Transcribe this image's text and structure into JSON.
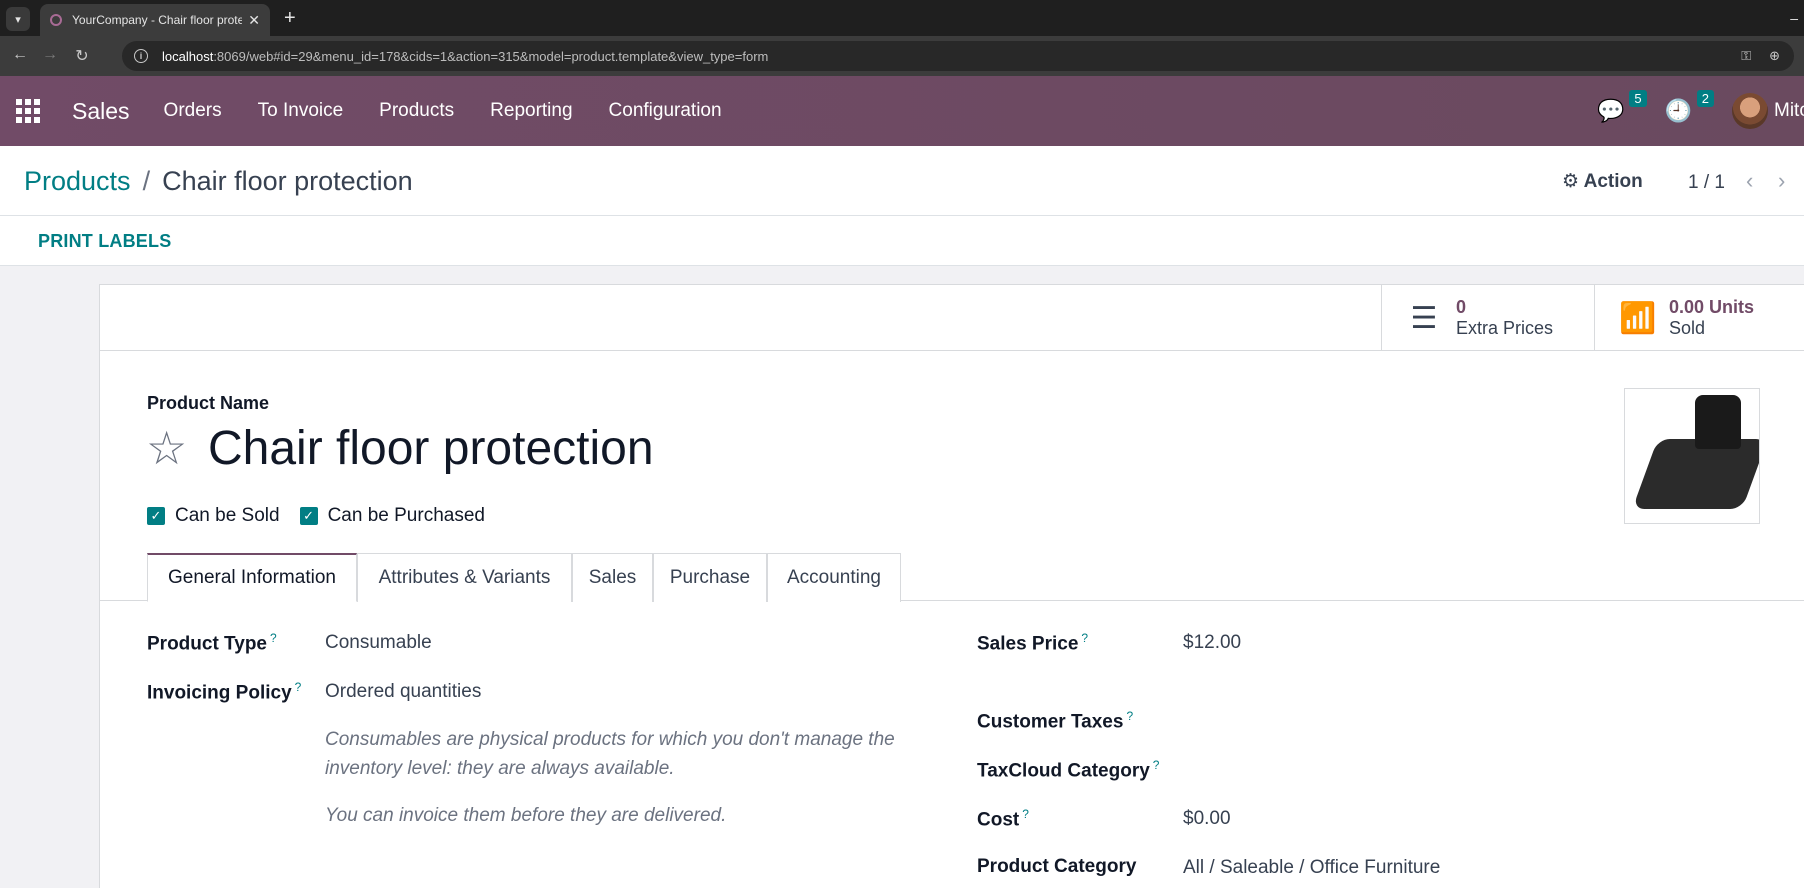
{
  "browser": {
    "tab_title": "YourCompany - Chair floor protection",
    "url_host": "localhost",
    "url_rest": ":8069/web#id=29&menu_id=178&cids=1&action=315&model=product.template&view_type=form"
  },
  "navbar": {
    "app_name": "Sales",
    "menu": [
      "Orders",
      "To Invoice",
      "Products",
      "Reporting",
      "Configuration"
    ],
    "messages_count": "5",
    "activities_count": "2",
    "user_name": "Mitchell Admin"
  },
  "control": {
    "breadcrumb_parent": "Products",
    "breadcrumb_sep": "/",
    "breadcrumb_current": "Chair floor protection",
    "action_label": "Action",
    "pager": "1 / 1"
  },
  "statusbar": {
    "print_labels": "PRINT LABELS"
  },
  "stat_buttons": {
    "extra_prices_value": "0",
    "extra_prices_label": "Extra Prices",
    "units_sold_value": "0.00 Units",
    "units_sold_label": "Sold"
  },
  "form": {
    "product_name_label": "Product Name",
    "product_name": "Chair floor protection",
    "can_be_sold": "Can be Sold",
    "can_be_purchased": "Can be Purchased",
    "tabs": [
      "General Information",
      "Attributes & Variants",
      "Sales",
      "Purchase",
      "Accounting"
    ],
    "fields": {
      "product_type_label": "Product Type",
      "product_type_value": "Consumable",
      "invoicing_policy_label": "Invoicing Policy",
      "invoicing_policy_value": "Ordered quantities",
      "help_1": "Consumables are physical products for which you don't manage the inventory level: they are always available.",
      "help_2": "You can invoice them before they are delivered.",
      "sales_price_label": "Sales Price",
      "sales_price_value": "$12.00",
      "customer_taxes_label": "Customer Taxes",
      "taxcloud_category_label": "TaxCloud Category",
      "cost_label": "Cost",
      "cost_value": "$0.00",
      "product_category_label": "Product Category",
      "product_category_value": "All / Saleable / Office Furniture"
    },
    "help_marker": "?"
  }
}
